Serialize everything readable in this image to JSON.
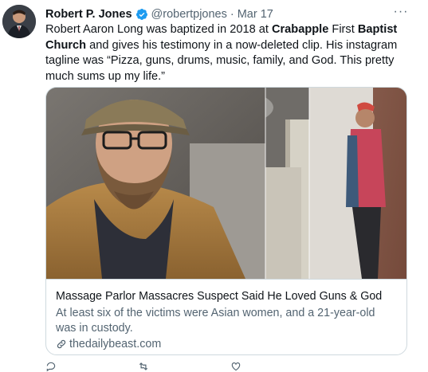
{
  "tweet": {
    "author_name": "Robert P. Jones",
    "author_handle": "@robertpjones",
    "separator": "·",
    "date": "Mar 17",
    "text_parts": [
      "Robert Aaron Long was baptized in 2018 at ",
      "Crabapple",
      " First ",
      "Baptist Church",
      " and gives his testimony in a now-deleted clip. His instagram tagline was “Pizza, guns, drums, music, family, and God. This pretty much sums up my life.”"
    ],
    "more_icon": "more-horizontal-icon",
    "verified_color": "#1d9bf0"
  },
  "card": {
    "title": "Massage Parlor Massacres Suspect Said He Loved Guns & God",
    "description": "At least six of the victims were Asian women, and a 21-year-old was in custody.",
    "domain": "thedailybeast.com",
    "link_icon": "link-icon"
  },
  "actions": {
    "reply_icon": "reply-icon",
    "reply_count": "",
    "retweet_icon": "retweet-icon",
    "retweet_count": "",
    "like_icon": "heart-icon",
    "like_count": ""
  }
}
